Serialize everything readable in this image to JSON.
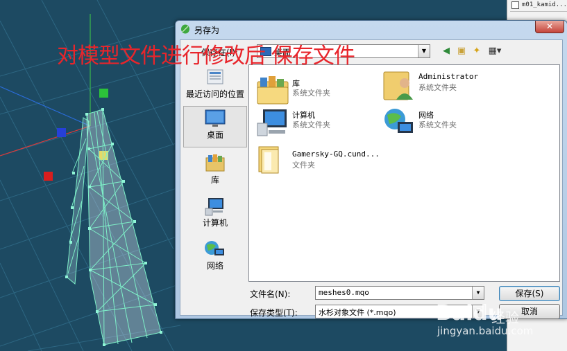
{
  "caption": "对模型文件进行修改后 保存文件",
  "side_panel": {
    "object_name": "m01_kamid..."
  },
  "dialog": {
    "title": "另存为",
    "save_in_label": "保存在(I):",
    "save_in_value": "桌面",
    "close_glyph": "✕",
    "places": [
      {
        "label": "最近访问的位置",
        "icon": "recent-places-icon"
      },
      {
        "label": "桌面",
        "icon": "desktop-icon"
      },
      {
        "label": "库",
        "icon": "libraries-icon"
      },
      {
        "label": "计算机",
        "icon": "computer-icon"
      },
      {
        "label": "网络",
        "icon": "network-icon"
      }
    ],
    "files": [
      {
        "name": "库",
        "type": "系统文件夹",
        "icon": "libraries-folder-icon"
      },
      {
        "name": "Administrator",
        "type": "系统文件夹",
        "icon": "user-folder-icon"
      },
      {
        "name": "计算机",
        "type": "系统文件夹",
        "icon": "computer-icon"
      },
      {
        "name": "网络",
        "type": "系统文件夹",
        "icon": "network-icon"
      },
      {
        "name": "Gamersky-GQ.cund...",
        "type": "文件夹",
        "icon": "folder-icon"
      }
    ],
    "filename_label": "文件名(N):",
    "filename_value": "meshes0.mqo",
    "filetype_label": "保存类型(T):",
    "filetype_value": "水杉对象文件 (*.mqo)",
    "save_button": "保存(S)",
    "cancel_button": "取消"
  },
  "watermark": {
    "logo": "Baidu",
    "sub": "经验",
    "url": "jingyan.baidu.com"
  },
  "colors": {
    "viewport_bg": "#1d4a62",
    "caption": "#e8252b",
    "mesh": "#7ef0c8"
  }
}
